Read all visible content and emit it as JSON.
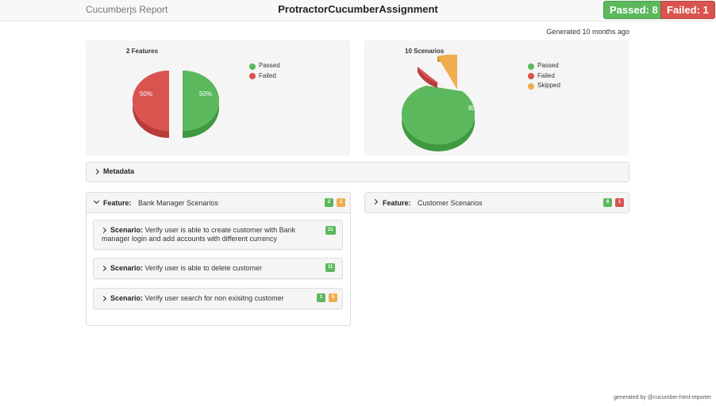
{
  "navbar": {
    "brand": "Cucumberjs Report",
    "project": "ProtractorCucumberAssignment",
    "passed_badge": "Passed: 8",
    "failed_badge": "Failed: 1"
  },
  "generated": "Generated 10 months ago",
  "features_chart": {
    "title": "2 Features",
    "legend": [
      {
        "label": "Passed",
        "color": "#5cb85c"
      },
      {
        "label": "Failed",
        "color": "#d9534f"
      }
    ]
  },
  "scenarios_chart": {
    "title": "10 Scenarios",
    "legend": [
      {
        "label": "Passed",
        "color": "#5cb85c"
      },
      {
        "label": "Failed",
        "color": "#d9534f"
      },
      {
        "label": "Skipped",
        "color": "#f0ad4e"
      }
    ]
  },
  "chart_data": [
    {
      "type": "pie",
      "title": "2 Features",
      "categories": [
        "Passed",
        "Failed"
      ],
      "values": [
        50,
        50
      ],
      "data_labels": [
        "50%",
        "50%"
      ],
      "legend": "right"
    },
    {
      "type": "pie",
      "title": "10 Scenarios",
      "categories": [
        "Passed",
        "Failed",
        "Skipped"
      ],
      "values": [
        80,
        10,
        10
      ],
      "data_labels": [
        "80%",
        "",
        ""
      ],
      "legend": "right"
    }
  ],
  "metadata": {
    "label": "Metadata"
  },
  "features": [
    {
      "keyword": "Feature:",
      "name": "Bank Manager Scenarios",
      "badges": [
        "2",
        "1"
      ],
      "scenarios": [
        {
          "keyword": "Scenario:",
          "name": "Verify user is able to create customer with Bank manager login and add accounts with different currency",
          "badges": [
            "21"
          ]
        },
        {
          "keyword": "Scenario:",
          "name": "Verify user is able to delete customer",
          "badges": [
            "11"
          ]
        },
        {
          "keyword": "Scenario:",
          "name": "Verify user search for non exisitng customer",
          "badges": [
            "1",
            "5"
          ]
        }
      ]
    },
    {
      "keyword": "Feature:",
      "name": "Customer Scenarios",
      "badges": [
        "6",
        "1"
      ]
    }
  ],
  "footer": "generated by @cucumber-html-reporter"
}
